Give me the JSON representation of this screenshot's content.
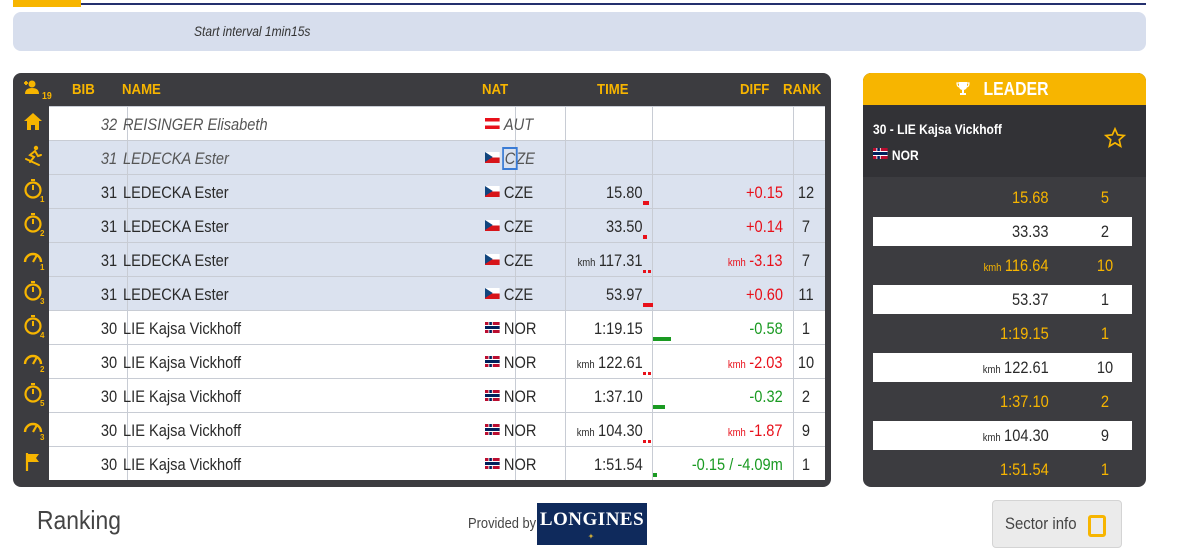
{
  "header": {
    "interval_text": "Start interval 1min15s"
  },
  "table": {
    "columns": {
      "count_badge": "19",
      "bib": "BIB",
      "name": "NAME",
      "nat": "NAT",
      "time": "TIME",
      "diff": "DIFF",
      "rank": "RANK"
    },
    "rows": [
      {
        "icon": "home-icon",
        "bib": "32",
        "name": "REISINGER Elisabeth",
        "nat": "AUT",
        "flag": "aut",
        "time": "",
        "time_unit": "",
        "diff": "",
        "diff_unit": "",
        "diff_color": "",
        "rank": "",
        "style": "italic"
      },
      {
        "icon": "skier-icon",
        "bib": "31",
        "name": "LEDECKA Ester",
        "nat": "CZE",
        "flag": "cze",
        "time": "",
        "time_unit": "",
        "diff": "",
        "diff_unit": "",
        "diff_color": "",
        "rank": "",
        "style": "italic-highlight"
      },
      {
        "icon": "stopwatch-1-icon",
        "bib": "31",
        "name": "LEDECKA Ester",
        "nat": "CZE",
        "flag": "cze",
        "time": "15.80",
        "time_unit": "",
        "diff": "+0.15",
        "diff_unit": "",
        "diff_color": "#e8101a",
        "rank": "12",
        "style": "highlight"
      },
      {
        "icon": "stopwatch-2-icon",
        "bib": "31",
        "name": "LEDECKA Ester",
        "nat": "CZE",
        "flag": "cze",
        "time": "33.50",
        "time_unit": "",
        "diff": "+0.14",
        "diff_unit": "",
        "diff_color": "#e8101a",
        "rank": "7",
        "style": "highlight"
      },
      {
        "icon": "speed-gauge-1-icon",
        "bib": "31",
        "name": "LEDECKA Ester",
        "nat": "CZE",
        "flag": "cze",
        "time": "117.31",
        "time_unit": "kmh",
        "diff": "-3.13",
        "diff_unit": "kmh",
        "diff_color": "#e8101a",
        "rank": "7",
        "style": "highlight"
      },
      {
        "icon": "stopwatch-3-icon",
        "bib": "31",
        "name": "LEDECKA Ester",
        "nat": "CZE",
        "flag": "cze",
        "time": "53.97",
        "time_unit": "",
        "diff": "+0.60",
        "diff_unit": "",
        "diff_color": "#e8101a",
        "rank": "11",
        "style": "highlight"
      },
      {
        "icon": "stopwatch-4-icon",
        "bib": "30",
        "name": "LIE Kajsa Vickhoff",
        "nat": "NOR",
        "flag": "nor",
        "time": "1:19.15",
        "time_unit": "",
        "diff": "-0.58",
        "diff_unit": "",
        "diff_color": "#1a9a22",
        "rank": "1",
        "style": "normal"
      },
      {
        "icon": "speed-gauge-2-icon",
        "bib": "30",
        "name": "LIE Kajsa Vickhoff",
        "nat": "NOR",
        "flag": "nor",
        "time": "122.61",
        "time_unit": "kmh",
        "diff": "-2.03",
        "diff_unit": "kmh",
        "diff_color": "#e8101a",
        "rank": "10",
        "style": "normal"
      },
      {
        "icon": "stopwatch-5-icon",
        "bib": "30",
        "name": "LIE Kajsa Vickhoff",
        "nat": "NOR",
        "flag": "nor",
        "time": "1:37.10",
        "time_unit": "",
        "diff": "-0.32",
        "diff_unit": "",
        "diff_color": "#1a9a22",
        "rank": "2",
        "style": "normal"
      },
      {
        "icon": "speed-gauge-3-icon",
        "bib": "30",
        "name": "LIE Kajsa Vickhoff",
        "nat": "NOR",
        "flag": "nor",
        "time": "104.30",
        "time_unit": "kmh",
        "diff": "-1.87",
        "diff_unit": "kmh",
        "diff_color": "#e8101a",
        "rank": "9",
        "style": "normal"
      },
      {
        "icon": "finish-flag-icon",
        "bib": "30",
        "name": "LIE Kajsa Vickhoff",
        "nat": "NOR",
        "flag": "nor",
        "time": "1:51.54",
        "time_unit": "",
        "diff": "-0.15 / -4.09m",
        "diff_unit": "",
        "diff_color": "#1a9a22",
        "rank": "1",
        "style": "normal"
      }
    ]
  },
  "leader": {
    "title": "LEADER",
    "name": "30 - LIE Kajsa Vickhoff",
    "nat": "NOR",
    "splits": [
      {
        "value": "15.68",
        "unit": "",
        "rank": "5",
        "style": "dark"
      },
      {
        "value": "33.33",
        "unit": "",
        "rank": "2",
        "style": "white"
      },
      {
        "value": "116.64",
        "unit": "kmh",
        "rank": "10",
        "style": "dark"
      },
      {
        "value": "53.37",
        "unit": "",
        "rank": "1",
        "style": "white"
      },
      {
        "value": "1:19.15",
        "unit": "",
        "rank": "1",
        "style": "dark"
      },
      {
        "value": "122.61",
        "unit": "kmh",
        "rank": "10",
        "style": "white"
      },
      {
        "value": "1:37.10",
        "unit": "",
        "rank": "2",
        "style": "dark"
      },
      {
        "value": "104.30",
        "unit": "kmh",
        "rank": "9",
        "style": "white"
      },
      {
        "value": "1:51.54",
        "unit": "",
        "rank": "1",
        "style": "dark"
      }
    ]
  },
  "footer": {
    "ranking_label": "Ranking",
    "provided_by": "Provided by",
    "sponsor_logo": "LONGINES",
    "sector_info_label": "Sector info"
  },
  "colors": {
    "accent": "#f7b500",
    "panel": "#3c3c40",
    "navy": "#24306e",
    "negative": "#e8101a",
    "positive": "#1a9a22"
  }
}
